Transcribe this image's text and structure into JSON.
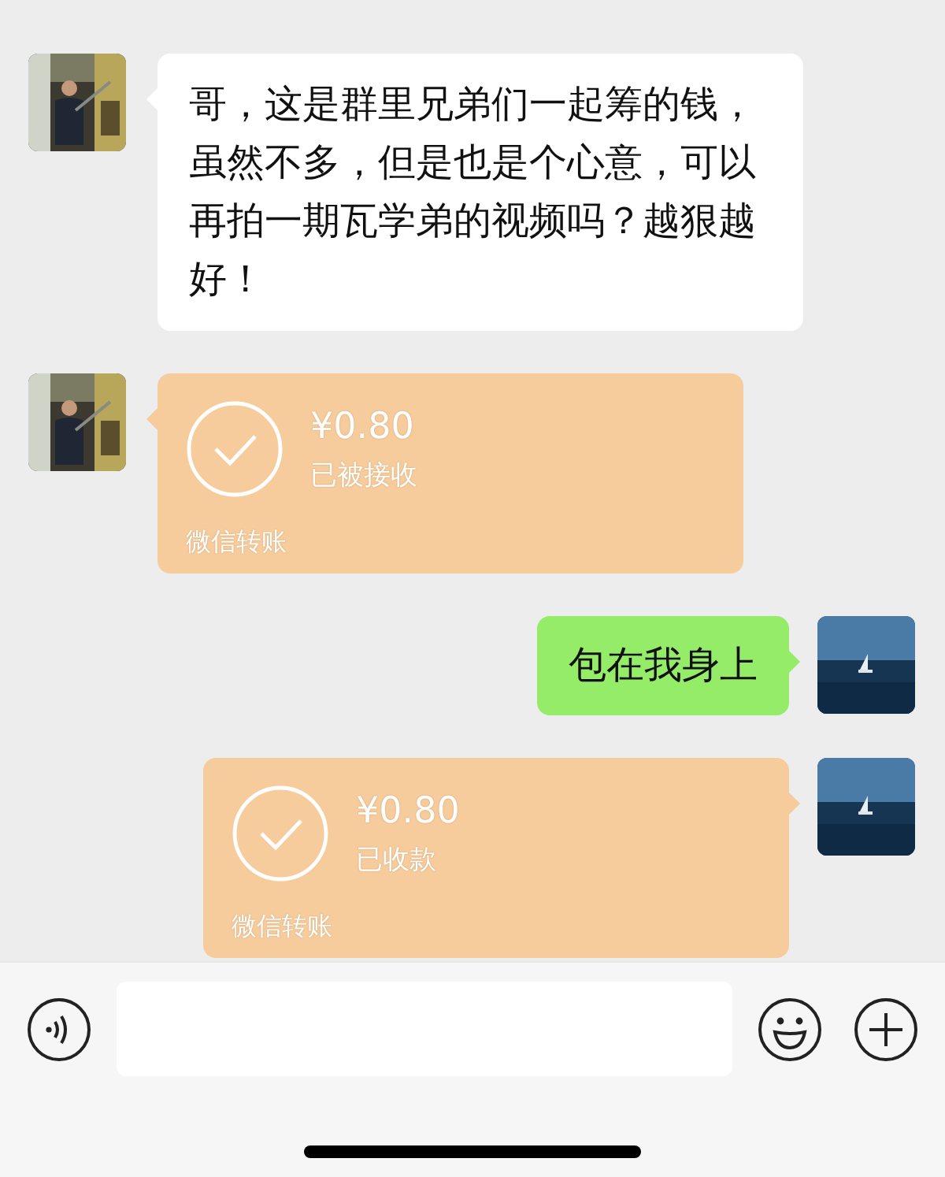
{
  "messages": [
    {
      "kind": "text",
      "sent": false,
      "text": "哥，这是群里兄弟们一起筹的钱，虽然不多，但是也是个心意，可以再拍一期瓦学弟的视频吗？越狠越好！"
    },
    {
      "kind": "transfer",
      "sent": false,
      "amount": "¥0.80",
      "status": "已被接收",
      "footer": "微信转账"
    },
    {
      "kind": "text",
      "sent": true,
      "text": "包在我身上"
    },
    {
      "kind": "transfer",
      "sent": true,
      "amount": "¥0.80",
      "status": "已收款",
      "footer": "微信转账"
    }
  ]
}
